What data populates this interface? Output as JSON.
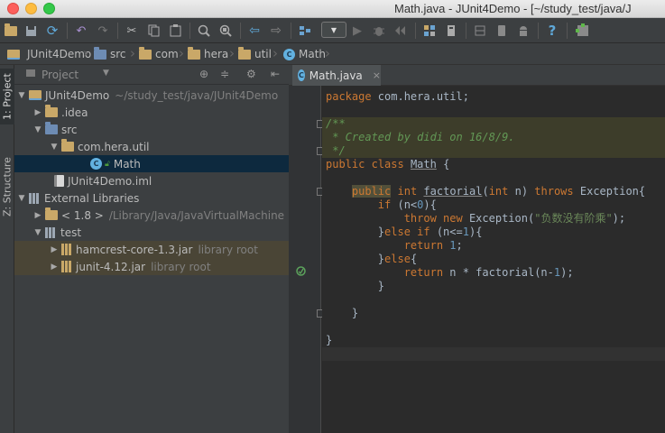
{
  "window": {
    "title": "Math.java - JUnit4Demo - [~/study_test/java/J"
  },
  "toolbar": {
    "icons": [
      "folder-open-icon",
      "save-icon",
      "sync-icon",
      "undo-icon",
      "redo-icon",
      "cut-icon",
      "copy-icon",
      "paste-icon",
      "find-icon",
      "find-replace-icon",
      "back-icon",
      "forward-icon",
      "build-icon",
      "run-config-dropdown",
      "run-icon",
      "debug-icon",
      "coverage-icon",
      "project-structure-icon",
      "sdk-icon",
      "avd-icon",
      "android-icon",
      "help-icon",
      "plugin-icon"
    ],
    "run_config_glyph": "▼"
  },
  "breadcrumbs": [
    {
      "label": "JUnit4Demo"
    },
    {
      "label": "src"
    },
    {
      "label": "com"
    },
    {
      "label": "hera"
    },
    {
      "label": "util"
    },
    {
      "label": "Math"
    }
  ],
  "left_strip": {
    "project_tab": "1: Project",
    "structure_tab": "Z: Structure"
  },
  "project_panel": {
    "title": "Project",
    "tree": [
      {
        "label": "JUnit4Demo",
        "extra": "~/study_test/java/JUnit4Demo",
        "indent": 0,
        "twisty": "▼",
        "icon": "module"
      },
      {
        "label": ".idea",
        "extra": "",
        "indent": 1,
        "twisty": "▶",
        "icon": "folder"
      },
      {
        "label": "src",
        "extra": "",
        "indent": 1,
        "twisty": "▼",
        "icon": "folder-blue"
      },
      {
        "label": "com.hera.util",
        "extra": "",
        "indent": 2,
        "twisty": "▼",
        "icon": "folder"
      },
      {
        "label": "Math",
        "extra": "",
        "indent": 4,
        "twisty": "",
        "icon": "class",
        "selected": true
      },
      {
        "label": "JUnit4Demo.iml",
        "extra": "",
        "indent": 2,
        "twisty": "",
        "icon": "iml"
      },
      {
        "label": "External Libraries",
        "extra": "",
        "indent": 0,
        "twisty": "▼",
        "icon": "libraries"
      },
      {
        "label": "< 1.8 >",
        "extra": "/Library/Java/JavaVirtualMachine",
        "indent": 1,
        "twisty": "▶",
        "icon": "folder"
      },
      {
        "label": "test",
        "extra": "",
        "indent": 1,
        "twisty": "▼",
        "icon": "libraries"
      },
      {
        "label": "hamcrest-core-1.3.jar",
        "extra": "library root",
        "indent": 2,
        "twisty": "▶",
        "icon": "jar",
        "libroot": true
      },
      {
        "label": "junit-4.12.jar",
        "extra": "library root",
        "indent": 2,
        "twisty": "▶",
        "icon": "jar",
        "libroot": true
      }
    ]
  },
  "editor": {
    "tab_label": "Math.java",
    "tab_close": "×",
    "class_badge": "C",
    "lines": [
      {
        "html": "<span class=\"kw\">package</span> com.hera.util;"
      },
      {
        "html": ""
      },
      {
        "html": "<span class=\"doc\">/**</span>",
        "cls": "hl-doc"
      },
      {
        "html": "<span class=\"doc\"> * Created by didi on 16/8/9.</span>",
        "cls": "hl-doc"
      },
      {
        "html": "<span class=\"doc\"> */</span>",
        "cls": "hl-doc"
      },
      {
        "html": "<span class=\"kw\">public class</span> <span class=\"under\">Math</span> {"
      },
      {
        "html": ""
      },
      {
        "html": "    <span class=\"kw hl-word\">public</span> <span class=\"kw\">int</span> <span class=\"under\">factorial</span>(<span class=\"kw\">int</span> n) <span class=\"kw\">throws</span> Exception{"
      },
      {
        "html": "        <span class=\"kw\">if</span> (n&lt;<span class=\"num\">0</span>){"
      },
      {
        "html": "            <span class=\"kw\">throw new</span> Exception(<span class=\"str\">\"负数没有阶乘\"</span>);"
      },
      {
        "html": "        }<span class=\"kw\">else if</span> (n&lt;=<span class=\"num\">1</span>){"
      },
      {
        "html": "            <span class=\"kw\">return</span> <span class=\"num\">1</span>;"
      },
      {
        "html": "        }<span class=\"kw\">else</span>{"
      },
      {
        "html": "            <span class=\"kw\">return</span> n * factorial(n-<span class=\"num\">1</span>);"
      },
      {
        "html": "        }"
      },
      {
        "html": ""
      },
      {
        "html": "    }"
      },
      {
        "html": ""
      },
      {
        "html": "}"
      },
      {
        "html": "",
        "cls": "caret-line"
      }
    ]
  }
}
